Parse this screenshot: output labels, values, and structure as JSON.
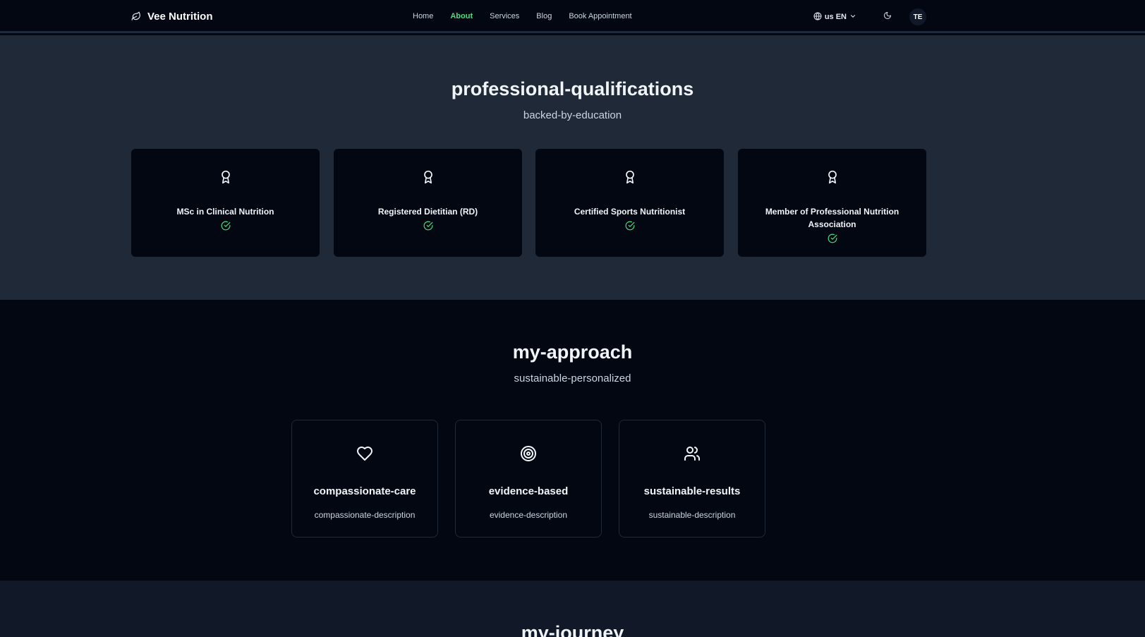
{
  "header": {
    "brand": "Vee Nutrition",
    "nav": [
      "Home",
      "About",
      "Services",
      "Blog",
      "Book Appointment"
    ],
    "active_nav": "About",
    "lang_label": "us EN",
    "avatar_initials": "TE"
  },
  "qualifications": {
    "title": "professional-qualifications",
    "subtitle": "backed-by-education",
    "items": [
      {
        "label": "MSc in Clinical Nutrition"
      },
      {
        "label": "Registered Dietitian (RD)"
      },
      {
        "label": "Certified Sports Nutritionist"
      },
      {
        "label": "Member of Professional Nutrition Association"
      }
    ]
  },
  "approach": {
    "title": "my-approach",
    "subtitle": "sustainable-personalized",
    "items": [
      {
        "title": "compassionate-care",
        "description": "compassionate-description",
        "icon": "heart-icon"
      },
      {
        "title": "evidence-based",
        "description": "evidence-description",
        "icon": "target-icon"
      },
      {
        "title": "sustainable-results",
        "description": "sustainable-description",
        "icon": "users-icon"
      }
    ]
  },
  "journey": {
    "title": "my-journey"
  },
  "colors": {
    "accent": "#4ade80",
    "bg_dark": "#030712",
    "bg_section": "#1f2937"
  }
}
